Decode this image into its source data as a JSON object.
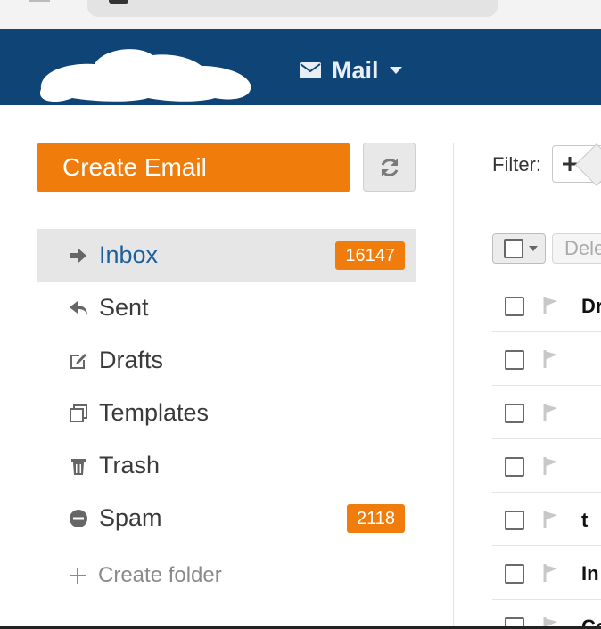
{
  "header": {
    "app_name": "Mail",
    "brand_color": "#0f4477",
    "logo": "redacted-logo"
  },
  "sidebar": {
    "create_email_label": "Create Email",
    "refresh_icon": "refresh-icon",
    "accent_color": "#f07c0c",
    "folders": [
      {
        "label": "Inbox",
        "icon": "arrow-right-icon",
        "count": "16147",
        "active": true
      },
      {
        "label": "Sent",
        "icon": "reply-icon",
        "count": ""
      },
      {
        "label": "Drafts",
        "icon": "edit-icon",
        "count": ""
      },
      {
        "label": "Templates",
        "icon": "templates-icon",
        "count": ""
      },
      {
        "label": "Trash",
        "icon": "trash-icon",
        "count": ""
      },
      {
        "label": "Spam",
        "icon": "minus-circle-icon",
        "count": "2118"
      }
    ],
    "create_folder_label": "Create folder"
  },
  "main": {
    "filter_label": "Filter:",
    "delete_label": "Delete",
    "messages": [
      {
        "subject": "Dr"
      },
      {
        "subject": ""
      },
      {
        "subject": ""
      },
      {
        "subject": ""
      },
      {
        "subject": "t"
      },
      {
        "subject": "In"
      },
      {
        "subject": "Co"
      }
    ]
  }
}
